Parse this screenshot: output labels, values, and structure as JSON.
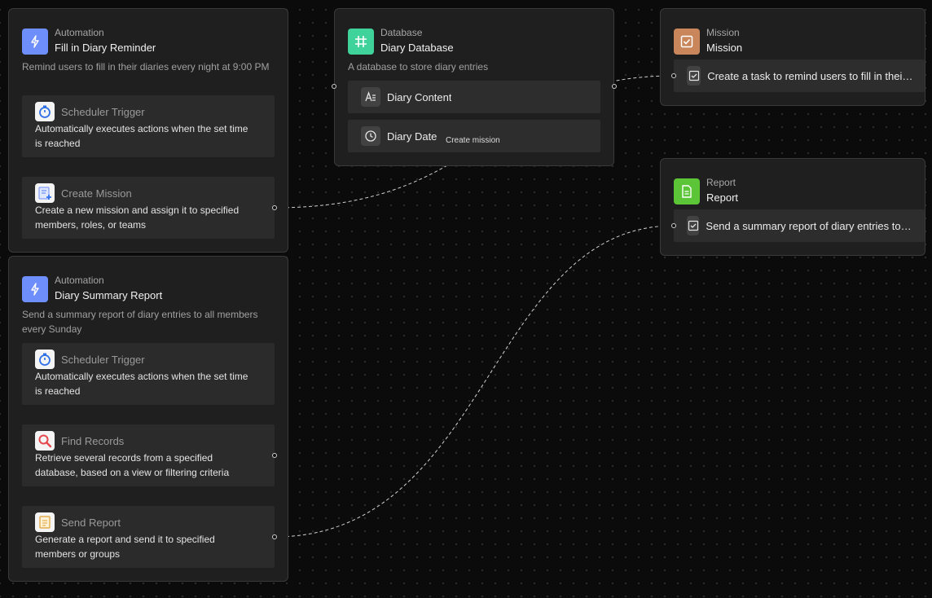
{
  "colors": {
    "automation_icon_bg": "#6e8efb",
    "database_icon_bg": "#3fd29a",
    "mission_icon_bg": "#c8865a",
    "report_icon_bg": "#5cc437",
    "canvas_bg": "#0b0b0b",
    "node_bg": "#1f1f1f"
  },
  "automation1": {
    "type": "Automation",
    "title": "Fill in Diary Reminder",
    "description": "Remind users to fill in their diaries every night at 9:00 PM",
    "icon": "lightning-icon",
    "steps": [
      {
        "title": "Scheduler Trigger",
        "description": "Automatically executes actions when the set time is reached",
        "icon": "stopwatch-icon"
      },
      {
        "title": "Create Mission",
        "description": "Create a new mission and assign it to specified members, roles, or teams",
        "icon": "create-mission-icon"
      }
    ]
  },
  "automation2": {
    "type": "Automation",
    "title": "Diary Summary Report",
    "description": "Send a summary report of diary entries to all members every Sunday",
    "icon": "lightning-icon",
    "steps": [
      {
        "title": "Scheduler Trigger",
        "description": "Automatically executes actions when the set time is reached",
        "icon": "stopwatch-icon"
      },
      {
        "title": "Find Records",
        "description": "Retrieve several records from a specified database, based on a view or filtering criteria",
        "icon": "magnifier-icon"
      },
      {
        "title": "Send Report",
        "description": "Generate a report and send it to specified members or groups",
        "icon": "report-doc-icon"
      }
    ]
  },
  "database": {
    "type": "Database",
    "title": "Diary Database",
    "description": "A database to store diary entries",
    "icon": "grid-hash-icon",
    "fields": [
      {
        "label": "Diary Content",
        "icon": "long-text-icon"
      },
      {
        "label": "Diary Date",
        "icon": "clock-icon"
      }
    ]
  },
  "mission": {
    "type": "Mission",
    "title": "Mission",
    "icon": "checkbox-icon",
    "item": "Create a task to remind users to fill in their diaries every night"
  },
  "report": {
    "type": "Report",
    "title": "Report",
    "icon": "document-icon",
    "item": "Send a summary report of diary entries to all members every Sunday"
  },
  "edges": {
    "create_mission_label": "Create mission"
  }
}
